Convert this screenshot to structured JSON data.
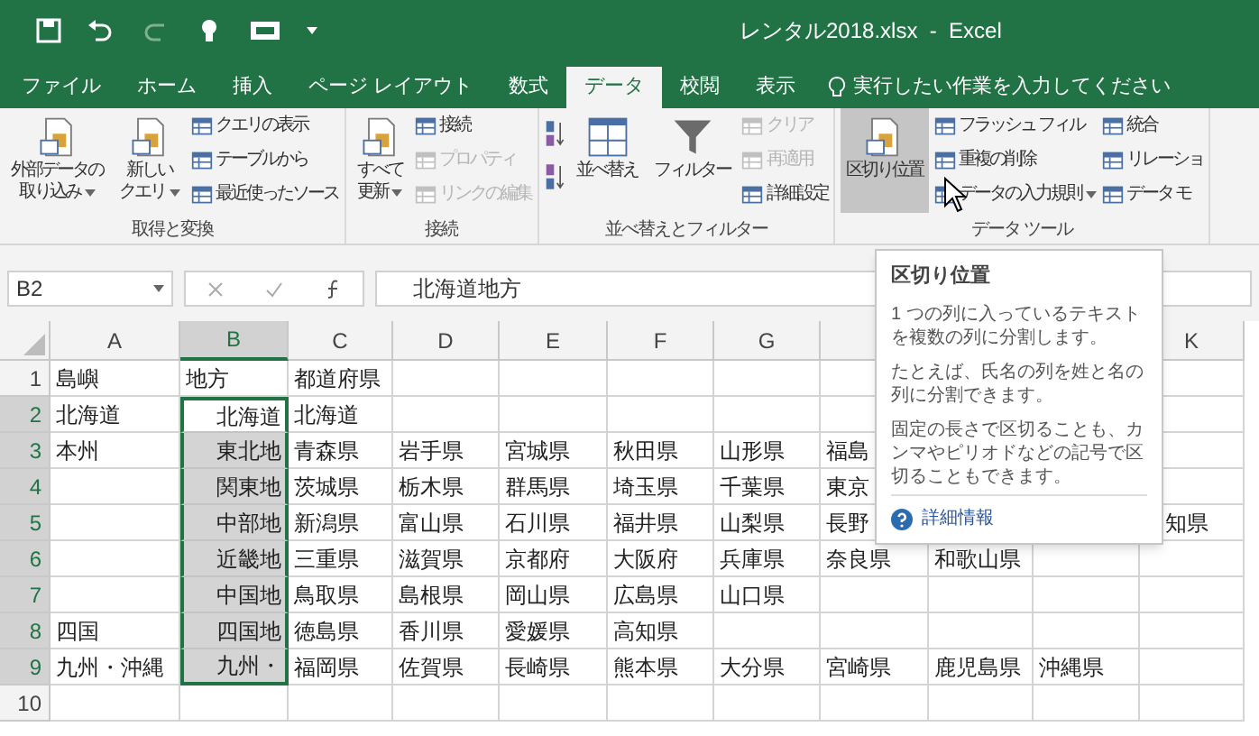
{
  "window": {
    "title": "レンタル2018.xlsx  -  Excel"
  },
  "tabs": [
    {
      "label": "ファイル",
      "selected": false
    },
    {
      "label": "ホーム",
      "selected": false
    },
    {
      "label": "挿入",
      "selected": false
    },
    {
      "label": "ページ レイアウト",
      "selected": false
    },
    {
      "label": "数式",
      "selected": false
    },
    {
      "label": "データ",
      "selected": true
    },
    {
      "label": "校閲",
      "selected": false
    },
    {
      "label": "表示",
      "selected": false
    }
  ],
  "tell_me": {
    "placeholder": "実行したい作業を入力してください"
  },
  "ribbon_groups": [
    {
      "label": "取得と変換",
      "commands": [
        {
          "kind": "large",
          "lines": [
            "外部データの",
            "取り込み"
          ],
          "dropdown": true,
          "highlighted": false
        },
        {
          "kind": "large",
          "lines": [
            "新しい",
            "クエリ"
          ],
          "dropdown": true,
          "highlighted": false
        },
        {
          "kind": "stack",
          "items": [
            {
              "label": "クエリの表示",
              "disabled": false,
              "dropdown": false
            },
            {
              "label": "テーブルから",
              "disabled": false,
              "dropdown": false
            },
            {
              "label": "最近使ったソース",
              "disabled": false,
              "dropdown": false
            }
          ]
        }
      ]
    },
    {
      "label": "接続",
      "commands": [
        {
          "kind": "large",
          "lines": [
            "すべて",
            "更新"
          ],
          "dropdown": true,
          "highlighted": false
        },
        {
          "kind": "stack",
          "items": [
            {
              "label": "接続",
              "disabled": false,
              "dropdown": false
            },
            {
              "label": "プロパティ",
              "disabled": true,
              "dropdown": false
            },
            {
              "label": "リンクの編集",
              "disabled": true,
              "dropdown": false
            }
          ]
        }
      ]
    },
    {
      "label": "並べ替えとフィルター",
      "commands": [
        {
          "kind": "sort_icons"
        },
        {
          "kind": "large",
          "lines": [
            "並べ替え"
          ],
          "dropdown": false,
          "highlighted": false
        },
        {
          "kind": "large",
          "lines": [
            "フィルター"
          ],
          "dropdown": false,
          "highlighted": false
        },
        {
          "kind": "stack",
          "items": [
            {
              "label": "クリア",
              "disabled": true,
              "dropdown": false
            },
            {
              "label": "再適用",
              "disabled": true,
              "dropdown": false
            },
            {
              "label": "詳細設定",
              "disabled": false,
              "dropdown": false
            }
          ]
        }
      ]
    },
    {
      "label": "データ ツール",
      "commands": [
        {
          "kind": "large",
          "lines": [
            "区切り位置"
          ],
          "dropdown": false,
          "highlighted": true
        },
        {
          "kind": "stack",
          "items": [
            {
              "label": "フラッシュ フィル",
              "disabled": false,
              "dropdown": false
            },
            {
              "label": "重複の削除",
              "disabled": false,
              "dropdown": false
            },
            {
              "label": "データの入力規則",
              "disabled": false,
              "dropdown": true
            }
          ]
        },
        {
          "kind": "stack",
          "items": [
            {
              "label": "統合",
              "disabled": false,
              "dropdown": false
            },
            {
              "label": "リレーショ",
              "disabled": false,
              "dropdown": false
            },
            {
              "label": "データ モ",
              "disabled": false,
              "dropdown": false
            }
          ]
        }
      ]
    }
  ],
  "formula_bar": {
    "name_box": "B2",
    "formula": "北海道地方"
  },
  "columns": [
    {
      "label": "A",
      "selected": false
    },
    {
      "label": "B",
      "selected": true
    },
    {
      "label": "C",
      "selected": false
    },
    {
      "label": "D",
      "selected": false
    },
    {
      "label": "E",
      "selected": false
    },
    {
      "label": "F",
      "selected": false
    },
    {
      "label": "G",
      "selected": false
    },
    null,
    null,
    null,
    {
      "label": "K",
      "selected": false
    }
  ],
  "rows": [
    {
      "label": "1",
      "selected": false,
      "cells": [
        "島嶼",
        "地方",
        "都道府県",
        null,
        null,
        null,
        null,
        null,
        null,
        null,
        null
      ]
    },
    {
      "label": "2",
      "selected": true,
      "cells": [
        "北海道",
        "北海道",
        "北海道",
        null,
        null,
        null,
        null,
        null,
        null,
        null,
        null
      ]
    },
    {
      "label": "3",
      "selected": true,
      "cells": [
        "本州",
        "東北地",
        "青森県",
        "岩手県",
        "宮城県",
        "秋田県",
        "山形県",
        "福島",
        null,
        null,
        null
      ]
    },
    {
      "label": "4",
      "selected": true,
      "cells": [
        null,
        "関東地",
        "茨城県",
        "栃木県",
        "群馬県",
        "埼玉県",
        "千葉県",
        "東京",
        null,
        null,
        null
      ]
    },
    {
      "label": "5",
      "selected": true,
      "cells": [
        null,
        "中部地",
        "新潟県",
        "富山県",
        "石川県",
        "福井県",
        "山梨県",
        "長野",
        null,
        null,
        "知県"
      ]
    },
    {
      "label": "6",
      "selected": true,
      "cells": [
        null,
        "近畿地",
        "三重県",
        "滋賀県",
        "京都府",
        "大阪府",
        "兵庫県",
        "奈良県",
        "和歌山県",
        null,
        null
      ]
    },
    {
      "label": "7",
      "selected": true,
      "cells": [
        null,
        "中国地",
        "鳥取県",
        "島根県",
        "岡山県",
        "広島県",
        "山口県",
        null,
        null,
        null,
        null
      ]
    },
    {
      "label": "8",
      "selected": true,
      "cells": [
        "四国",
        "四国地",
        "徳島県",
        "香川県",
        "愛媛県",
        "高知県",
        null,
        null,
        null,
        null,
        null
      ]
    },
    {
      "label": "9",
      "selected": true,
      "cells": [
        "九州・沖縄",
        "九州・",
        "福岡県",
        "佐賀県",
        "長崎県",
        "熊本県",
        "大分県",
        "宮崎県",
        "鹿児島県",
        "沖縄県",
        null
      ]
    },
    {
      "label": "10",
      "selected": false,
      "cells": [
        null,
        null,
        null,
        null,
        null,
        null,
        null,
        null,
        null,
        null,
        null
      ]
    }
  ],
  "tooltip": {
    "title": "区切り位置",
    "paragraphs": [
      "1 つの列に入っているテキストを複数の列に分割します。",
      "たとえば、氏名の列を姓と名の列に分割できます。",
      "固定の長さで区切ることも、カンマやピリオドなどの記号で区切ることもできます。"
    ],
    "link": "詳細情報"
  }
}
